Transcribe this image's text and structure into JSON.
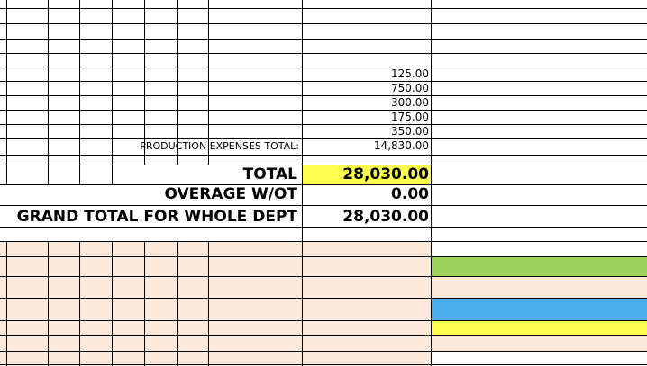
{
  "colors": {
    "grid": "#000000",
    "peach_fill": "#fbe9dc",
    "total_highlight": "#ffff4d",
    "green": "#9bd35a",
    "blue": "#4badea",
    "yellow": "#ffff4d"
  },
  "sheet": {
    "expense_values": [
      "125.00",
      "750.00",
      "300.00",
      "175.00",
      "350.00"
    ],
    "production_label": "PRODUCTION EXPENSES TOTAL:",
    "production_value": "14,830.00",
    "total_label": "TOTAL",
    "total_value": "28,030.00",
    "overage_label": "OVERAGE W/OT",
    "overage_value": "0.00",
    "grand_label": "GRAND TOTAL FOR WHOLE DEPT",
    "grand_value": "28,030.00"
  }
}
